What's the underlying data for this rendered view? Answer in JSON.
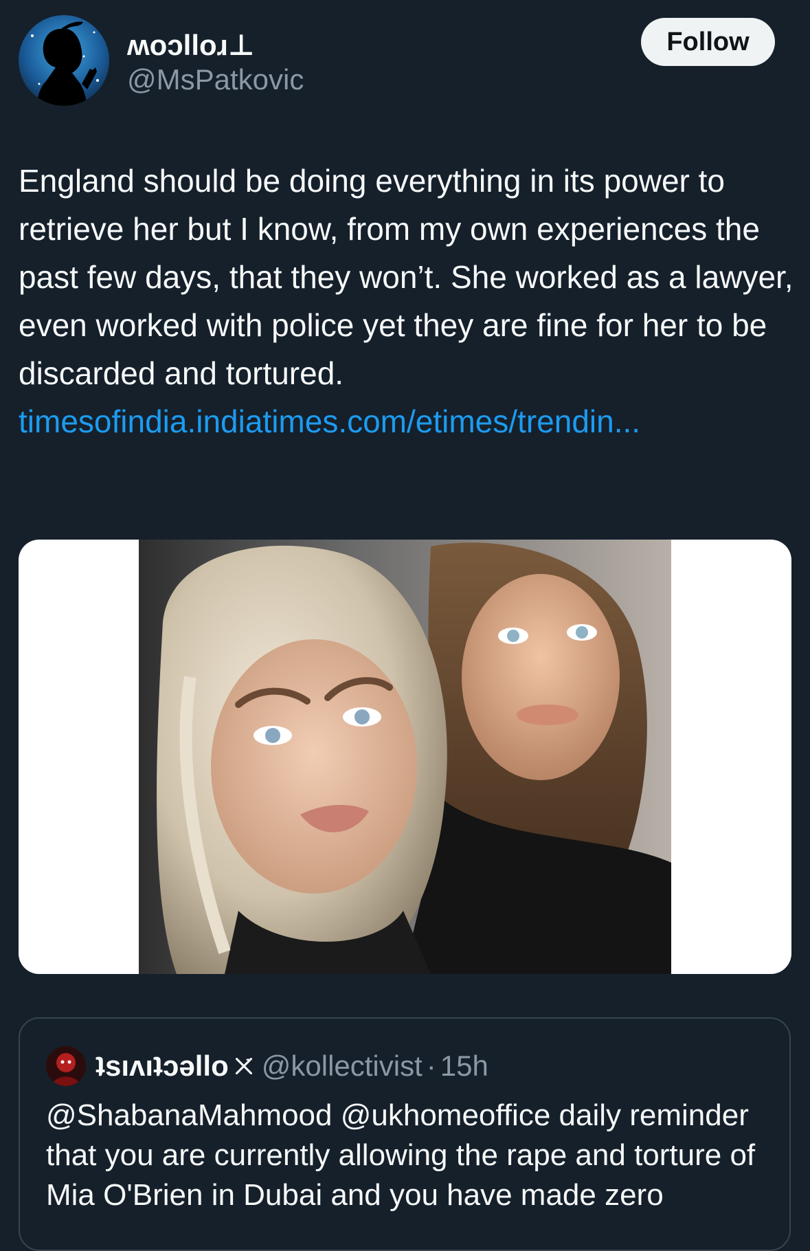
{
  "tweet": {
    "author": {
      "display_name": "ʍoɔlloɹ⊥",
      "handle": "@MsPatkovic",
      "avatar_icon": "silhouette-avatar-icon"
    },
    "follow_label": "Follow",
    "text_before_link": "England should be doing everything in its power to retrieve her but I know, from my own experiences the past few days, that they won’t. She worked as a lawyer, even worked with police yet they are fine for her to be discarded and tortured. ",
    "link_text": "timesofindia.indiatimes.com/etimes/trendin...",
    "media": {
      "image_icon": "photo-two-women-selfie"
    }
  },
  "quoted_tweet": {
    "display_name": "ʇsıʌıʇɔǝllo",
    "verified_icon": "x-mark-icon",
    "handle": "@kollectivist",
    "separator": "·",
    "time": "15h",
    "text": "@ShabanaMahmood @ukhomeoffice daily reminder that you are currently allowing the rape and torture of Mia O'Brien in Dubai and you have made zero"
  },
  "colors": {
    "background": "#15202b",
    "text_primary": "#f7f9f9",
    "text_secondary": "#8b98a5",
    "link": "#1d9bf0",
    "border": "#38444d",
    "follow_bg": "#eff3f4"
  }
}
